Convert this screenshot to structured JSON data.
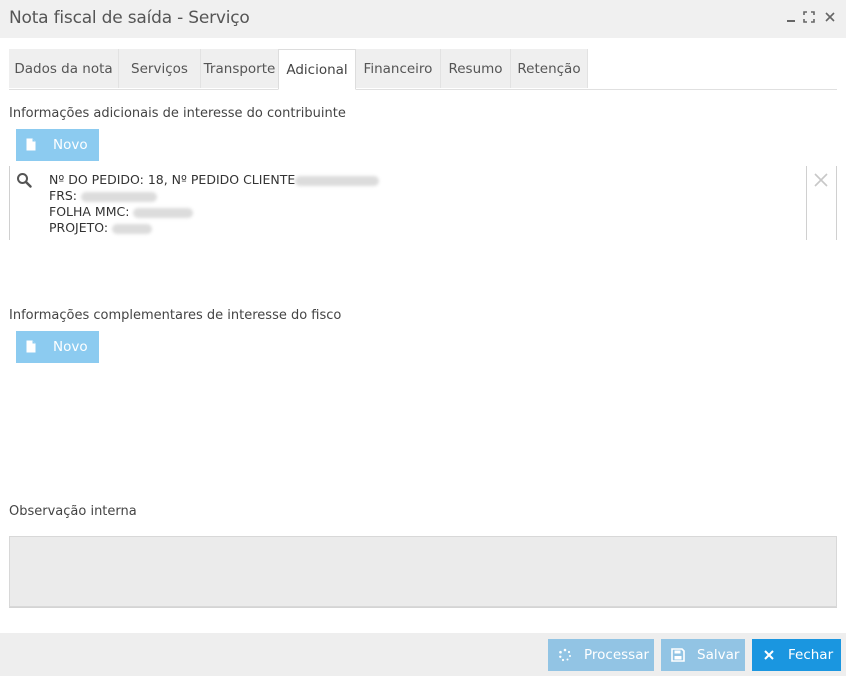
{
  "window": {
    "title": "Nota fiscal de saída - Serviço"
  },
  "tabs": [
    {
      "label": "Dados da nota"
    },
    {
      "label": "Serviços"
    },
    {
      "label": "Transporte"
    },
    {
      "label": "Adicional",
      "active": true
    },
    {
      "label": "Financeiro"
    },
    {
      "label": "Resumo"
    },
    {
      "label": "Retenção"
    }
  ],
  "contribuinte": {
    "label": "Informações adicionais de interesse do contribuinte",
    "novo_label": "Novo",
    "lines": [
      "Nº DO PEDIDO: 18, Nº PEDIDO CLIENTE",
      "FRS:",
      "FOLHA MMC:",
      "PROJETO:"
    ]
  },
  "fisco": {
    "label": "Informações complementares de interesse do fisco",
    "novo_label": "Novo"
  },
  "observacao": {
    "label": "Observação interna",
    "value": ""
  },
  "footer": {
    "processar_label": "Processar",
    "salvar_label": "Salvar",
    "fechar_label": "Fechar"
  },
  "colors": {
    "primary": "#1a96e0",
    "primary_disabled": "#8ccbf0",
    "disabled_footer": "#92c4e4"
  },
  "icons": {
    "search": "search-icon",
    "remove": "close-icon",
    "new": "file-icon",
    "process": "spinner-icon",
    "save": "floppy-icon",
    "close": "close-icon"
  }
}
